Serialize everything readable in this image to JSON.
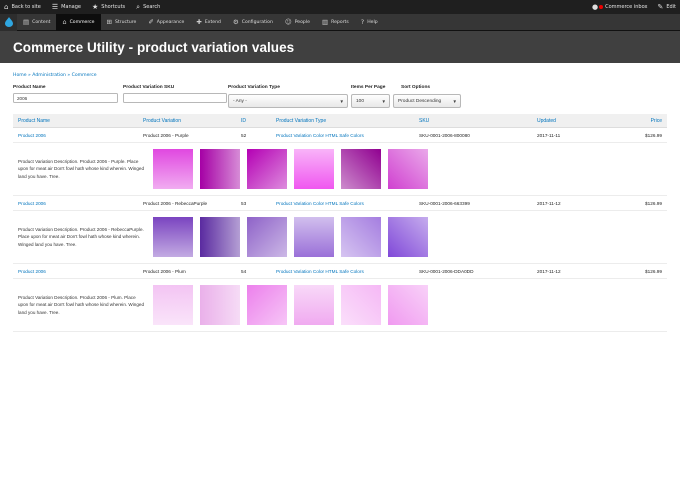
{
  "toolbar": {
    "back": "Back to site",
    "manage": "Manage",
    "shortcuts": "Shortcuts",
    "search": "Search",
    "inbox": "Commerce inbox",
    "edit": "Edit"
  },
  "tray": {
    "items": [
      "Content",
      "Commerce",
      "Structure",
      "Appearance",
      "Extend",
      "Configuration",
      "People",
      "Reports",
      "Help"
    ],
    "active": "Commerce"
  },
  "page_title": "Commerce Utility - product variation values",
  "breadcrumb": "Home » Administration » Commerce",
  "filters": {
    "product_name_label": "Product Name",
    "product_name_value": "2006",
    "sku_label": "Product Variation SKU",
    "sku_value": "",
    "type_label": "Product Variation Type",
    "type_value": "- Any -",
    "per_page_label": "Items Per Page",
    "per_page_value": "100",
    "sort_label": "Sort Options",
    "sort_value": "Product Descending"
  },
  "columns": [
    "Product Name",
    "Product Variation",
    "ID",
    "Product Variation Type",
    "SKU",
    "Updated",
    "Price"
  ],
  "rows": [
    {
      "product": "Product 2006",
      "variation": "Product 2006 - Purple",
      "id": "52",
      "type": "Product Variation Color HTML Safe Colors",
      "sku": "SKU-0001-2006-800080",
      "updated": "2017-11-11",
      "price": "$126.99",
      "description": "Product Variation Description. Product 2006 - Purple. Place upon for meat air Don't fowl hath whose kind wherein. Winged land you have. Tree.",
      "swatch_colors": [
        "#e048e0",
        "#a500a5",
        "#b400b4",
        "#f057f0",
        "#900090",
        "#d040d0"
      ]
    },
    {
      "product": "Product 2006",
      "variation": "Product 2006 - RebeccaPurple",
      "id": "53",
      "type": "Product Variation Color HTML Safe Colors",
      "sku": "SKU-0001-2006-663399",
      "updated": "2017-11-12",
      "price": "$126.99",
      "description": "Product Variation Description. Product 2006 - RebeccaPurple. Place upon for meat air Don't fowl hath whose kind wherein. Winged land you have. Tree.",
      "swatch_colors": [
        "#7a44c0",
        "#5a2aa0",
        "#8e62c8",
        "#9a70d8",
        "#a57ee0",
        "#8048d8"
      ]
    },
    {
      "product": "Product 2006",
      "variation": "Product 2006 - Plum",
      "id": "54",
      "type": "Product Variation Color HTML Safe Colors",
      "sku": "SKU-0001-2006-DDA0DD",
      "updated": "2017-11-12",
      "price": "$126.99",
      "description": "Product Variation Description. Product 2006 - Plum. Place upon for meat air Don't fowl hath whose kind wherein. Winged land you have. Tree.",
      "swatch_colors": [
        "#f3c4f3",
        "#eab0ea",
        "#ec80ec",
        "#f0aaf0",
        "#f5b8f5",
        "#f09af0"
      ]
    }
  ]
}
